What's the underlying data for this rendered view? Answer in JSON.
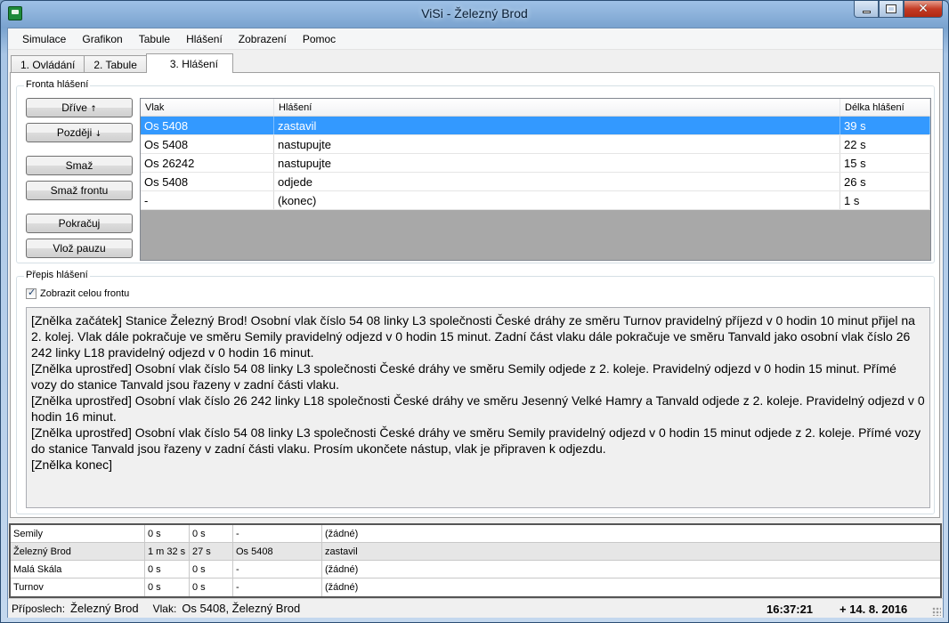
{
  "window": {
    "title": "ViSi - Železný Brod"
  },
  "menu": [
    "Simulace",
    "Grafikon",
    "Tabule",
    "Hlášení",
    "Zobrazení",
    "Pomoc"
  ],
  "tabs": [
    "1. Ovládání",
    "2. Tabule",
    "3. Hlášení"
  ],
  "active_tab": 2,
  "queue_group": {
    "label": "Fronta hlášení",
    "buttons": {
      "earlier": "Dříve",
      "earlier_arrow": "↑",
      "later": "Později",
      "later_arrow": "↓",
      "delete": "Smaž",
      "clear_queue": "Smaž frontu",
      "continue": "Pokračuj",
      "insert_pause": "Vlož pauzu"
    },
    "columns": [
      "Vlak",
      "Hlášení",
      "Délka hlášení"
    ],
    "rows": [
      {
        "train": "Os 5408",
        "announcement": "zastavil",
        "length": "39 s",
        "selected": true
      },
      {
        "train": "Os 5408",
        "announcement": "nastupujte",
        "length": "22 s"
      },
      {
        "train": "Os 26242",
        "announcement": "nastupujte",
        "length": "15 s"
      },
      {
        "train": "Os 5408",
        "announcement": "odjede",
        "length": "26 s"
      },
      {
        "train": "-",
        "announcement": "(konec)",
        "length": "1 s"
      }
    ]
  },
  "transcript_group": {
    "label": "Přepis hlášení",
    "show_full_queue_label": "Zobrazit celou frontu",
    "show_full_queue_checked": true,
    "lines": [
      "[Znělka začátek] Stanice Železný Brod! Osobní vlak číslo 54 08 linky L3 společnosti České dráhy ze směru Turnov pravidelný příjezd v 0 hodin 10 minut přijel na 2. kolej. Vlak dále pokračuje ve směru Semily pravidelný odjezd v 0 hodin 15 minut. Zadní část vlaku dále pokračuje ve směru Tanvald jako osobní vlak číslo 26 242 linky L18 pravidelný odjezd v 0 hodin 16 minut.",
      "[Znělka uprostřed] Osobní vlak číslo 54 08 linky L3 společnosti České dráhy ve směru Semily odjede z 2. koleje. Pravidelný odjezd v 0 hodin 15 minut. Přímé vozy do stanice Tanvald jsou řazeny v zadní části vlaku.",
      "[Znělka uprostřed] Osobní vlak číslo 26 242 linky L18 společnosti České dráhy ve směru Jesenný Velké Hamry a Tanvald odjede z 2. koleje. Pravidelný odjezd v 0 hodin 16 minut.",
      "[Znělka uprostřed] Osobní vlak číslo 54 08 linky L3 společnosti České dráhy ve směru Semily pravidelný odjezd v 0 hodin 15 minut odjede z 2. koleje. Přímé vozy do stanice Tanvald jsou řazeny v zadní části vlaku. Prosím ukončete nástup, vlak je připraven k odjezdu.",
      "[Znělka konec]"
    ]
  },
  "stations": [
    {
      "name": "Semily",
      "t1": "0 s",
      "t2": "0 s",
      "train": "-",
      "status": "(žádné)"
    },
    {
      "name": "Železný Brod",
      "t1": "1 m 32 s",
      "t2": "27 s",
      "train": "Os 5408",
      "status": "zastavil",
      "highlight": true
    },
    {
      "name": "Malá Skála",
      "t1": "0 s",
      "t2": "0 s",
      "train": "-",
      "status": "(žádné)"
    },
    {
      "name": "Turnov",
      "t1": "0 s",
      "t2": "0 s",
      "train": "-",
      "status": "(žádné)"
    }
  ],
  "statusbar": {
    "listen_label": "Příposlech:",
    "listen_value": "Železný Brod",
    "train_label": "Vlak:",
    "train_value": "Os 5408, Železný Brod",
    "time": "16:37:21",
    "date": "+ 14. 8. 2016"
  }
}
